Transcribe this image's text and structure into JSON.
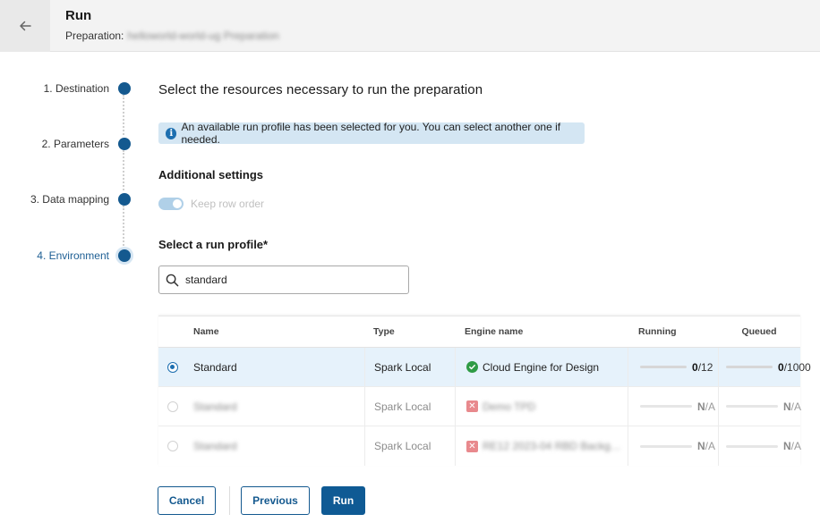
{
  "header": {
    "back_icon": "arrow-left-icon",
    "title": "Run",
    "subtitle_label": "Preparation:",
    "subtitle_value": "helloworld-world-ug Preparation"
  },
  "stepper": {
    "steps": [
      {
        "label": "1. Destination",
        "state": "done"
      },
      {
        "label": "2. Parameters",
        "state": "done"
      },
      {
        "label": "3. Data mapping",
        "state": "done"
      },
      {
        "label": "4. Environment",
        "state": "active"
      }
    ]
  },
  "main": {
    "title": "Select the resources necessary to run the preparation",
    "info_icon": "info-icon",
    "info_message": "An available run profile has been selected for you. You can select another one if needed.",
    "additional_settings_label": "Additional settings",
    "keep_row_order": {
      "label": "Keep row order",
      "enabled": true,
      "disabled": true
    },
    "run_profile_label": "Select a run profile*",
    "search": {
      "icon": "search-icon",
      "value": "standard",
      "placeholder": ""
    }
  },
  "table": {
    "columns": [
      "Name",
      "Type",
      "Engine name",
      "Running",
      "Queued"
    ],
    "rows": [
      {
        "selected": true,
        "disabled": false,
        "name": "Standard",
        "type": "Spark Local",
        "engine_status": "ok",
        "engine_name": "Cloud Engine for Design",
        "running": {
          "current": "0",
          "max": "/12",
          "fraction": 0
        },
        "queued": {
          "current": "0",
          "max": "/1000",
          "fraction": 0
        }
      },
      {
        "selected": false,
        "disabled": true,
        "name": "Standard",
        "type": "Spark Local",
        "engine_status": "error",
        "engine_name": "Demo TPD",
        "running": {
          "current": "N",
          "max": "/A",
          "fraction": 0
        },
        "queued": {
          "current": "N",
          "max": "/A",
          "fraction": 0
        }
      },
      {
        "selected": false,
        "disabled": true,
        "name": "Standard",
        "type": "Spark Local",
        "engine_status": "error",
        "engine_name": "RE12 2023-04 RBD Backg…",
        "running": {
          "current": "N",
          "max": "/A",
          "fraction": 0
        },
        "queued": {
          "current": "N",
          "max": "/A",
          "fraction": 0
        }
      }
    ]
  },
  "footer": {
    "cancel_label": "Cancel",
    "previous_label": "Previous",
    "run_label": "Run"
  },
  "colors": {
    "accent": "#14598f",
    "selected_row": "#e6f2fb",
    "info_bg": "#d4e6f3",
    "ok": "#2f9b45",
    "error": "#e8898d"
  }
}
